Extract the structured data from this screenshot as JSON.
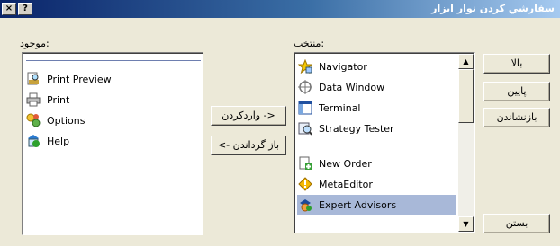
{
  "window": {
    "title": "سفارشي كردن نوار ابزار",
    "help_btn": "?",
    "close_btn": "×"
  },
  "available": {
    "label": ":موجود",
    "items": [
      {
        "label": "Print Preview",
        "icon": "print-preview-icon"
      },
      {
        "label": "Print",
        "icon": "printer-icon"
      },
      {
        "label": "Options",
        "icon": "options-icon"
      },
      {
        "label": "Help",
        "icon": "help-icon"
      }
    ]
  },
  "selected": {
    "label": ":منتخب",
    "items": [
      {
        "label": "Navigator",
        "icon": "navigator-star-icon"
      },
      {
        "label": "Data Window",
        "icon": "crosshair-icon"
      },
      {
        "label": "Terminal",
        "icon": "terminal-icon"
      },
      {
        "label": "Strategy Tester",
        "icon": "strategy-tester-icon"
      },
      {
        "label": "New Order",
        "icon": "new-order-icon"
      },
      {
        "label": "MetaEditor",
        "icon": "metaeditor-icon"
      },
      {
        "label": "Expert Advisors",
        "icon": "expert-advisors-icon"
      }
    ],
    "selected_item": "Expert Advisors"
  },
  "buttons": {
    "insert": "<- واردكردن",
    "remove": "باز گرداندن ->",
    "up": "بالا",
    "down": "پايين",
    "reset": "بازنشاندن",
    "close": "بستن"
  },
  "colors": {
    "title_start": "#0a246a",
    "selection": "#a8b8d8",
    "face": "#ece9d8"
  }
}
